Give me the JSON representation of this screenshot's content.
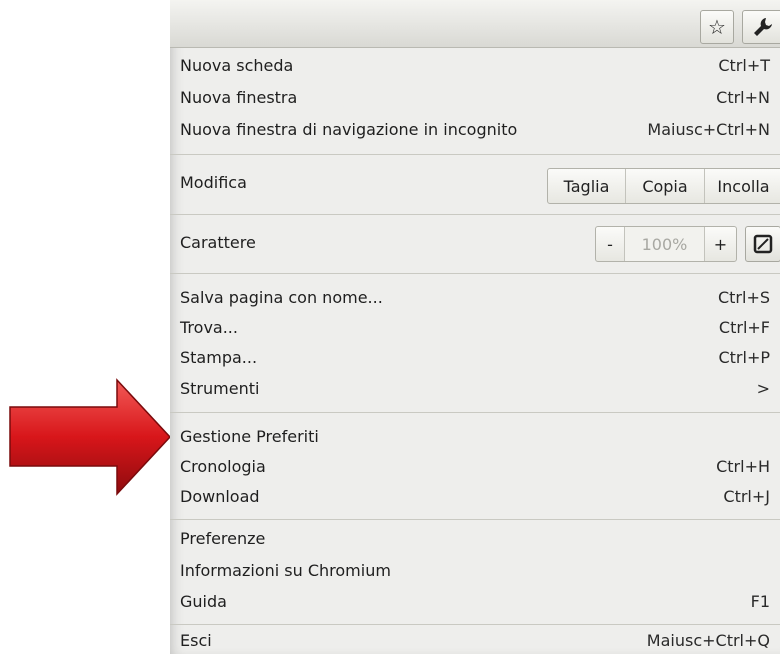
{
  "menu": {
    "top_items": [
      {
        "label": "Nuova scheda",
        "shortcut": "Ctrl+T"
      },
      {
        "label": "Nuova finestra",
        "shortcut": "Ctrl+N"
      },
      {
        "label": "Nuova finestra di navigazione in incognito",
        "shortcut": "Maiusc+Ctrl+N"
      }
    ],
    "edit": {
      "label": "Modifica",
      "cut": "Taglia",
      "copy": "Copia",
      "paste": "Incolla"
    },
    "zoom": {
      "label": "Carattere",
      "minus": "-",
      "value": "100%",
      "plus": "+"
    },
    "page_items": [
      {
        "label": "Salva pagina con nome...",
        "shortcut": "Ctrl+S"
      },
      {
        "label": "Trova...",
        "shortcut": "Ctrl+F"
      },
      {
        "label": "Stampa...",
        "shortcut": "Ctrl+P"
      },
      {
        "label": "Strumenti",
        "shortcut": ">"
      }
    ],
    "history_items": [
      {
        "label": "Gestione Preferiti",
        "shortcut": ""
      },
      {
        "label": "Cronologia",
        "shortcut": "Ctrl+H"
      },
      {
        "label": "Download",
        "shortcut": "Ctrl+J"
      }
    ],
    "settings_items": [
      {
        "label": "Preferenze",
        "shortcut": ""
      },
      {
        "label": "Informazioni su Chromium",
        "shortcut": ""
      },
      {
        "label": "Guida",
        "shortcut": "F1"
      }
    ],
    "exit": {
      "label": "Esci",
      "shortcut": "Maiusc+Ctrl+Q"
    }
  },
  "icons": {
    "star": "star-icon",
    "wrench": "wrench-icon",
    "fullscreen": "fullscreen-icon",
    "arrow": "red-arrow-icon"
  },
  "colors": {
    "arrow": "#d8161a",
    "menu_bg": "#eeeeec"
  }
}
